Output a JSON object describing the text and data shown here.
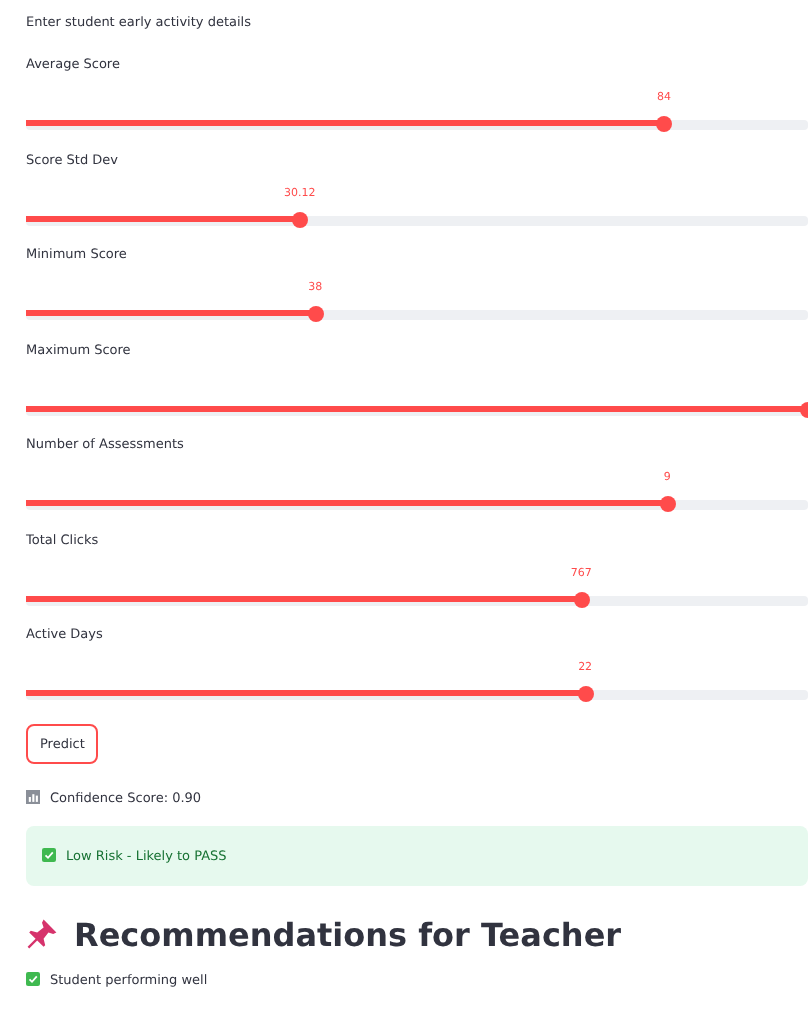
{
  "intro": "Enter student early activity details",
  "sliders": [
    {
      "label": "Average Score",
      "value": "84",
      "level": 0.816
    },
    {
      "label": "Score Std Dev",
      "value": "30.12",
      "level": 0.35
    },
    {
      "label": "Minimum Score",
      "value": "38",
      "level": 0.37
    },
    {
      "label": "Maximum Score",
      "level": 1.0
    },
    {
      "label": "Number of Assessments",
      "value": "9",
      "level": 0.82
    },
    {
      "label": "Total Clicks",
      "value": "767",
      "level": 0.71
    },
    {
      "label": "Active Days",
      "value": "22",
      "level": 0.715
    }
  ],
  "predict_button": "Predict",
  "confidence": "Confidence Score: 0.90",
  "result": {
    "kind": "success",
    "text": "Low Risk - Likely to PASS"
  },
  "recommendations": {
    "title": "Recommendations for Teacher",
    "items": [
      {
        "kind": "success",
        "text": "Student performing well"
      }
    ]
  }
}
